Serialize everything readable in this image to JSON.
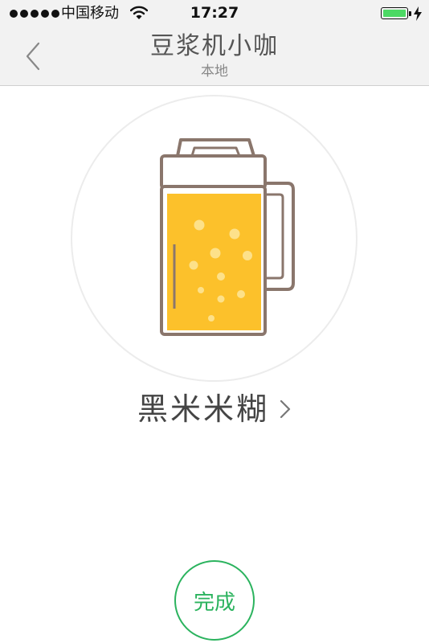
{
  "status_bar": {
    "signal_dots": 5,
    "carrier": "中国移动",
    "time": "17:27",
    "battery_color": "#4cd964"
  },
  "nav": {
    "title": "豆浆机小咖",
    "subtitle": "本地",
    "back_icon": "chevron-left-icon"
  },
  "device": {
    "illustration_icon": "soymilk-jug-icon",
    "fill_color": "#fcc12b",
    "program_name": "黑米米糊",
    "program_chevron": "chevron-right-icon"
  },
  "actions": {
    "done_label": "完成",
    "accent_color": "#2bb35e"
  }
}
